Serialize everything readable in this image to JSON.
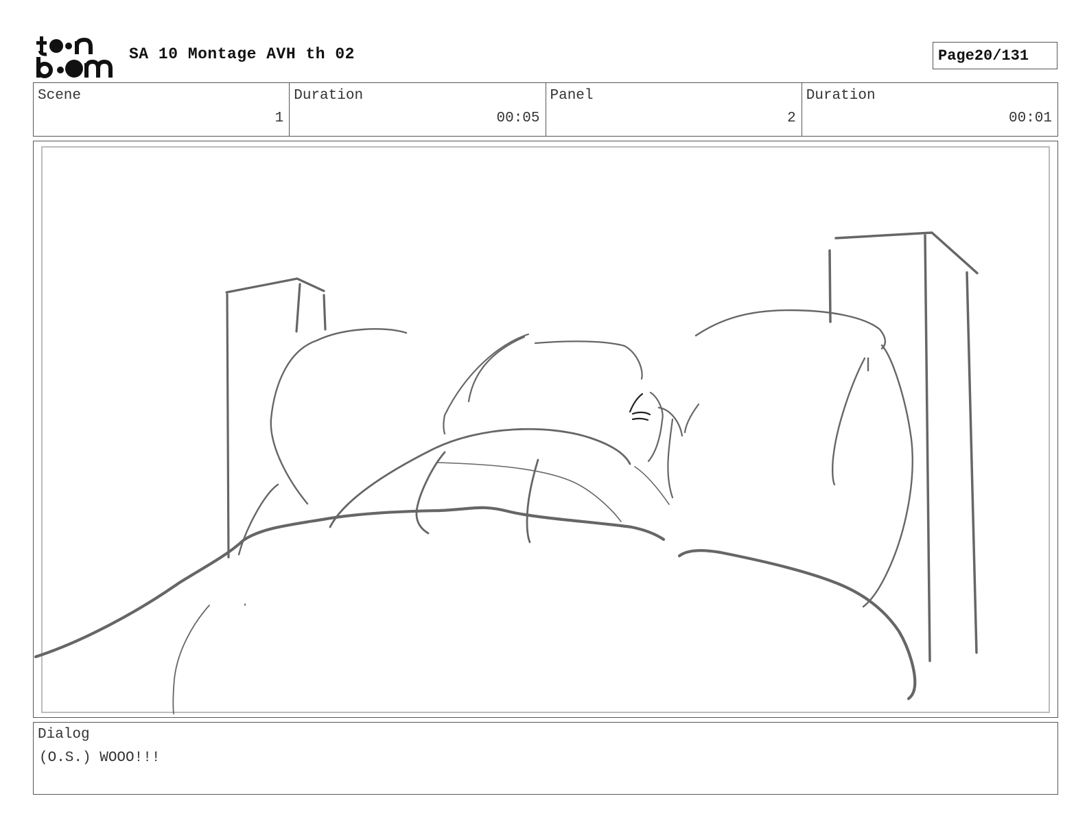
{
  "header": {
    "logo_alt": "toon boom",
    "project_title": "SA 10 Montage AVH th 02",
    "page_label": "Page",
    "page_value": "20/131"
  },
  "info": {
    "scene_label": "Scene",
    "scene_value": "1",
    "scene_duration_label": "Duration",
    "scene_duration_value": "00:05",
    "panel_label": "Panel",
    "panel_value": "2",
    "panel_duration_label": "Duration",
    "panel_duration_value": "00:01"
  },
  "dialog": {
    "label": "Dialog",
    "text": "(O.S.) WOOO!!!"
  },
  "colors": {
    "sketch_stroke": "#666666",
    "frame_border": "#555555"
  }
}
